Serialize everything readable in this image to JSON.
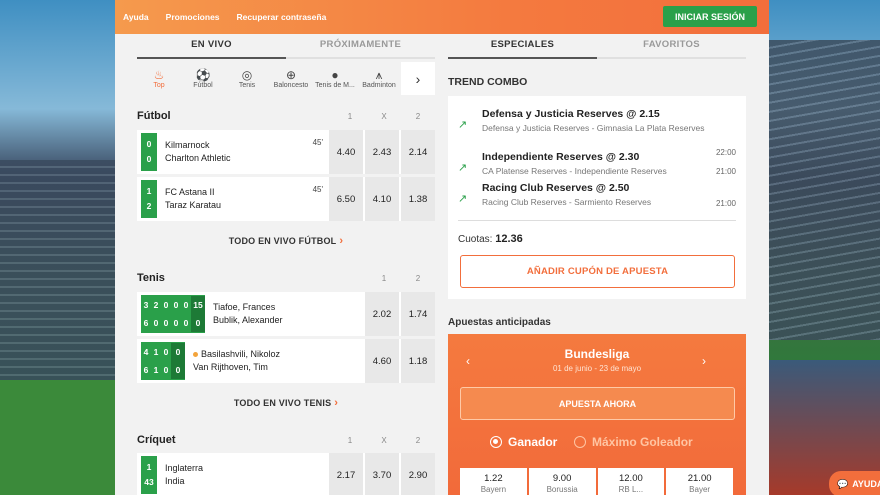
{
  "topbar": {
    "links": [
      "Ayuda",
      "Promociones",
      "Recuperar contraseña"
    ],
    "login_label": "INICIAR SESIÓN"
  },
  "left_tabs": [
    "EN VIVO",
    "PRÓXIMAMENTE"
  ],
  "right_tabs": [
    "ESPECIALES",
    "FAVORITOS"
  ],
  "sports": [
    {
      "label": "Top",
      "icon": "flame-icon"
    },
    {
      "label": "Fútbol",
      "icon": "soccer-ball-icon"
    },
    {
      "label": "Tenis",
      "icon": "tennis-ball-icon"
    },
    {
      "label": "Baloncesto",
      "icon": "basketball-icon"
    },
    {
      "label": "Tenis de M...",
      "icon": "table-tennis-icon"
    },
    {
      "label": "Badminton",
      "icon": "badminton-icon"
    }
  ],
  "futbol": {
    "title": "Fútbol",
    "cols": [
      "1",
      "X",
      "2"
    ],
    "matches": [
      {
        "score": [
          "0",
          "0"
        ],
        "home": "Kilmarnock",
        "away": "Charlton Athletic",
        "minute": "45'",
        "odds": [
          "4.40",
          "2.43",
          "2.14"
        ]
      },
      {
        "score": [
          "1",
          "2"
        ],
        "home": "FC Astana II",
        "away": "Taraz Karatau",
        "minute": "45'",
        "odds": [
          "6.50",
          "4.10",
          "1.38"
        ]
      }
    ],
    "all_label": "TODO EN VIVO FÚTBOL"
  },
  "tenis": {
    "title": "Tenis",
    "cols": [
      "1",
      "2"
    ],
    "matches": [
      {
        "sets": [
          [
            "3",
            "2",
            "0",
            "0",
            "0"
          ],
          [
            "6",
            "0",
            "0",
            "0",
            "0"
          ]
        ],
        "points": [
          "15",
          "0"
        ],
        "p1": "Tiafoe, Frances",
        "p2": "Bublik, Alexander",
        "odds": [
          "2.02",
          "1.74"
        ]
      },
      {
        "sets": [
          [
            "4",
            "1",
            "0"
          ],
          [
            "6",
            "1",
            "0"
          ]
        ],
        "points": [
          "0",
          "0"
        ],
        "p1": "Basilashvili, Nikoloz",
        "p2": "Van Rijthoven, Tim",
        "odds": [
          "4.60",
          "1.18"
        ]
      }
    ],
    "all_label": "TODO EN VIVO TENIS"
  },
  "criquet": {
    "title": "Críquet",
    "cols": [
      "1",
      "X",
      "2"
    ],
    "match": {
      "score": [
        "1",
        "43"
      ],
      "home": "Inglaterra",
      "away": "India",
      "odds": [
        "2.17",
        "3.70",
        "2.90"
      ]
    }
  },
  "trend": {
    "title": "TREND COMBO",
    "items": [
      {
        "title": "Defensa y Justicia Reserves @ 2.15",
        "desc": "Defensa y Justicia Reserves - Gimnasia La Plata Reserves",
        "time": "22:00"
      },
      {
        "title": "Independiente Reserves @ 2.30",
        "desc": "CA Platense Reserves - Independiente Reserves",
        "time": "21:00"
      },
      {
        "title": "Racing Club Reserves @ 2.50",
        "desc": "Racing Club Reserves - Sarmiento Reserves",
        "time": "21:00"
      }
    ],
    "cuotas_label": "Cuotas:",
    "cuotas_value": "12.36",
    "add_button": "AÑADIR CUPÓN DE APUESTA"
  },
  "anticipadas": {
    "title": "Apuestas anticipadas",
    "league": "Bundesliga",
    "dates": "01 de junio - 23 de mayo",
    "bet_button": "APUESTA AHORA",
    "options": [
      "Ganador",
      "Máximo Goleador"
    ],
    "teams": [
      {
        "odd": "1.22",
        "name": "Bayern"
      },
      {
        "odd": "9.00",
        "name": "Borussia"
      },
      {
        "odd": "12.00",
        "name": "RB L..."
      },
      {
        "odd": "21.00",
        "name": "Bayer"
      }
    ]
  },
  "chat": {
    "label": "AYUDA"
  },
  "colors": {
    "accent": "#f26e3c",
    "live_green": "#2aa04a"
  }
}
